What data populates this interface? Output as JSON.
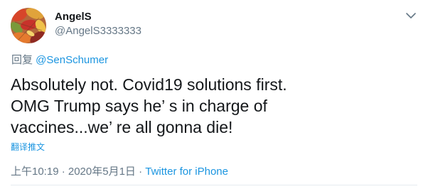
{
  "author": {
    "name": "AngelS",
    "handle": "@AngelS3333333"
  },
  "reply": {
    "prefix": "回复 ",
    "mention": "@SenSchumer"
  },
  "tweet": {
    "text": "Absolutely not. Covid19 solutions first.\nOMG Trump says he’ s in charge of\nvaccines...we’ re all gonna die!",
    "translate_label": "翻译推文"
  },
  "meta": {
    "timestamp": "上午10:19 · 2020年5月1日 · ",
    "source": "Twitter for iPhone"
  },
  "icons": {
    "menu": "chevron-down-icon",
    "avatar": "autumn-leaves-image"
  },
  "colors": {
    "link": "#1b95e0",
    "secondary_text": "#657786",
    "primary_text": "#14171a"
  }
}
